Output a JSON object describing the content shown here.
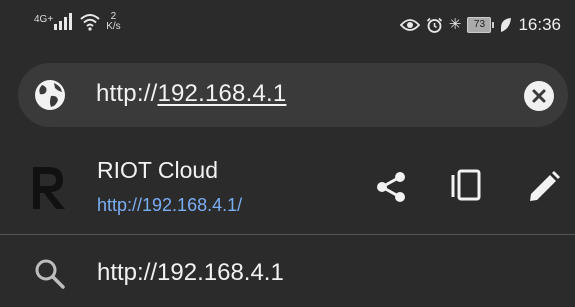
{
  "status_bar": {
    "network_type": "4G+",
    "speed_value": "2",
    "speed_unit": "K/s",
    "battery": "73",
    "time": "16:36"
  },
  "url_bar": {
    "scheme": "http://",
    "host": "192.168.4.1",
    "icons": {
      "site": "globe-icon",
      "clear": "close-circle-icon"
    }
  },
  "suggestion": {
    "title": "RIOT Cloud",
    "url": "http://192.168.4.1/",
    "actions": [
      "share-icon",
      "copy-icon",
      "edit-icon"
    ]
  },
  "search_suggestion": {
    "text": "http://192.168.4.1",
    "icon": "search-icon"
  },
  "colors": {
    "background": "#2b2b2b",
    "url_bar_bg": "#3a3a3a",
    "link": "#7aaef2",
    "text": "#f2f2f2"
  }
}
